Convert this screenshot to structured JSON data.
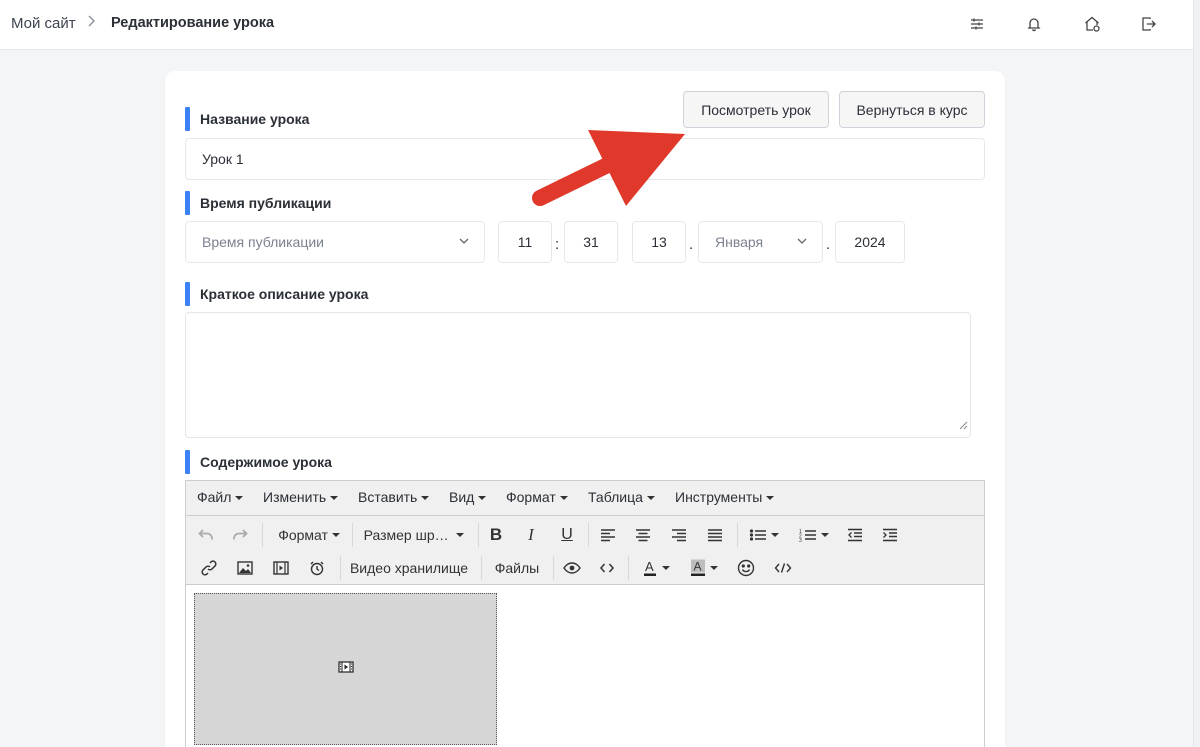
{
  "breadcrumb": {
    "root": "Мой сайт",
    "separator": ">",
    "current": "Редактирование урока"
  },
  "top_icons": [
    "sliders-icon",
    "bell-icon",
    "home-settings-icon",
    "logout-icon"
  ],
  "buttons": {
    "view_lesson": "Посмотреть урок",
    "back_to_course": "Вернуться в курс"
  },
  "lesson_name": {
    "label": "Название урока",
    "value": "Урок 1"
  },
  "publish": {
    "label": "Время публикации",
    "select_placeholder": "Время публикации",
    "hour": "11",
    "minute": "31",
    "day": "13",
    "month": "Января",
    "year": "2024",
    "time_sep": ":",
    "date_sep": "."
  },
  "description": {
    "label": "Краткое описание урока",
    "value": ""
  },
  "content": {
    "label": "Содержимое урока",
    "menu": [
      "Файл",
      "Изменить",
      "Вставить",
      "Вид",
      "Формат",
      "Таблица",
      "Инструменты"
    ],
    "toolbar": {
      "format": "Формат",
      "font_size": "Размер шр…",
      "video_storage": "Видео хранилище",
      "files": "Файлы"
    }
  },
  "colors": {
    "accent": "#3b82f6",
    "arrow": "#e0392b"
  }
}
